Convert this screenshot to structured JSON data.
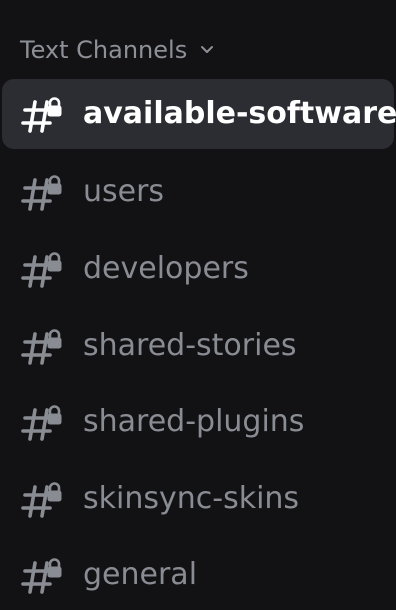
{
  "category": {
    "label": "Text Channels",
    "icon": "chevron-down-icon"
  },
  "channels": [
    {
      "label": "available-software",
      "icon": "locked-hash-icon",
      "selected": true
    },
    {
      "label": "users",
      "icon": "locked-hash-icon",
      "selected": false
    },
    {
      "label": "developers",
      "icon": "locked-hash-icon",
      "selected": false
    },
    {
      "label": "shared-stories",
      "icon": "locked-hash-icon",
      "selected": false
    },
    {
      "label": "shared-plugins",
      "icon": "locked-hash-icon",
      "selected": false
    },
    {
      "label": "skinsync-skins",
      "icon": "locked-hash-icon",
      "selected": false
    },
    {
      "label": "general",
      "icon": "locked-hash-icon",
      "selected": false
    }
  ],
  "colors": {
    "background": "#121214",
    "selected_background": "#2c2d32",
    "muted_text": "#8a8c93",
    "active_text": "#ffffff"
  }
}
